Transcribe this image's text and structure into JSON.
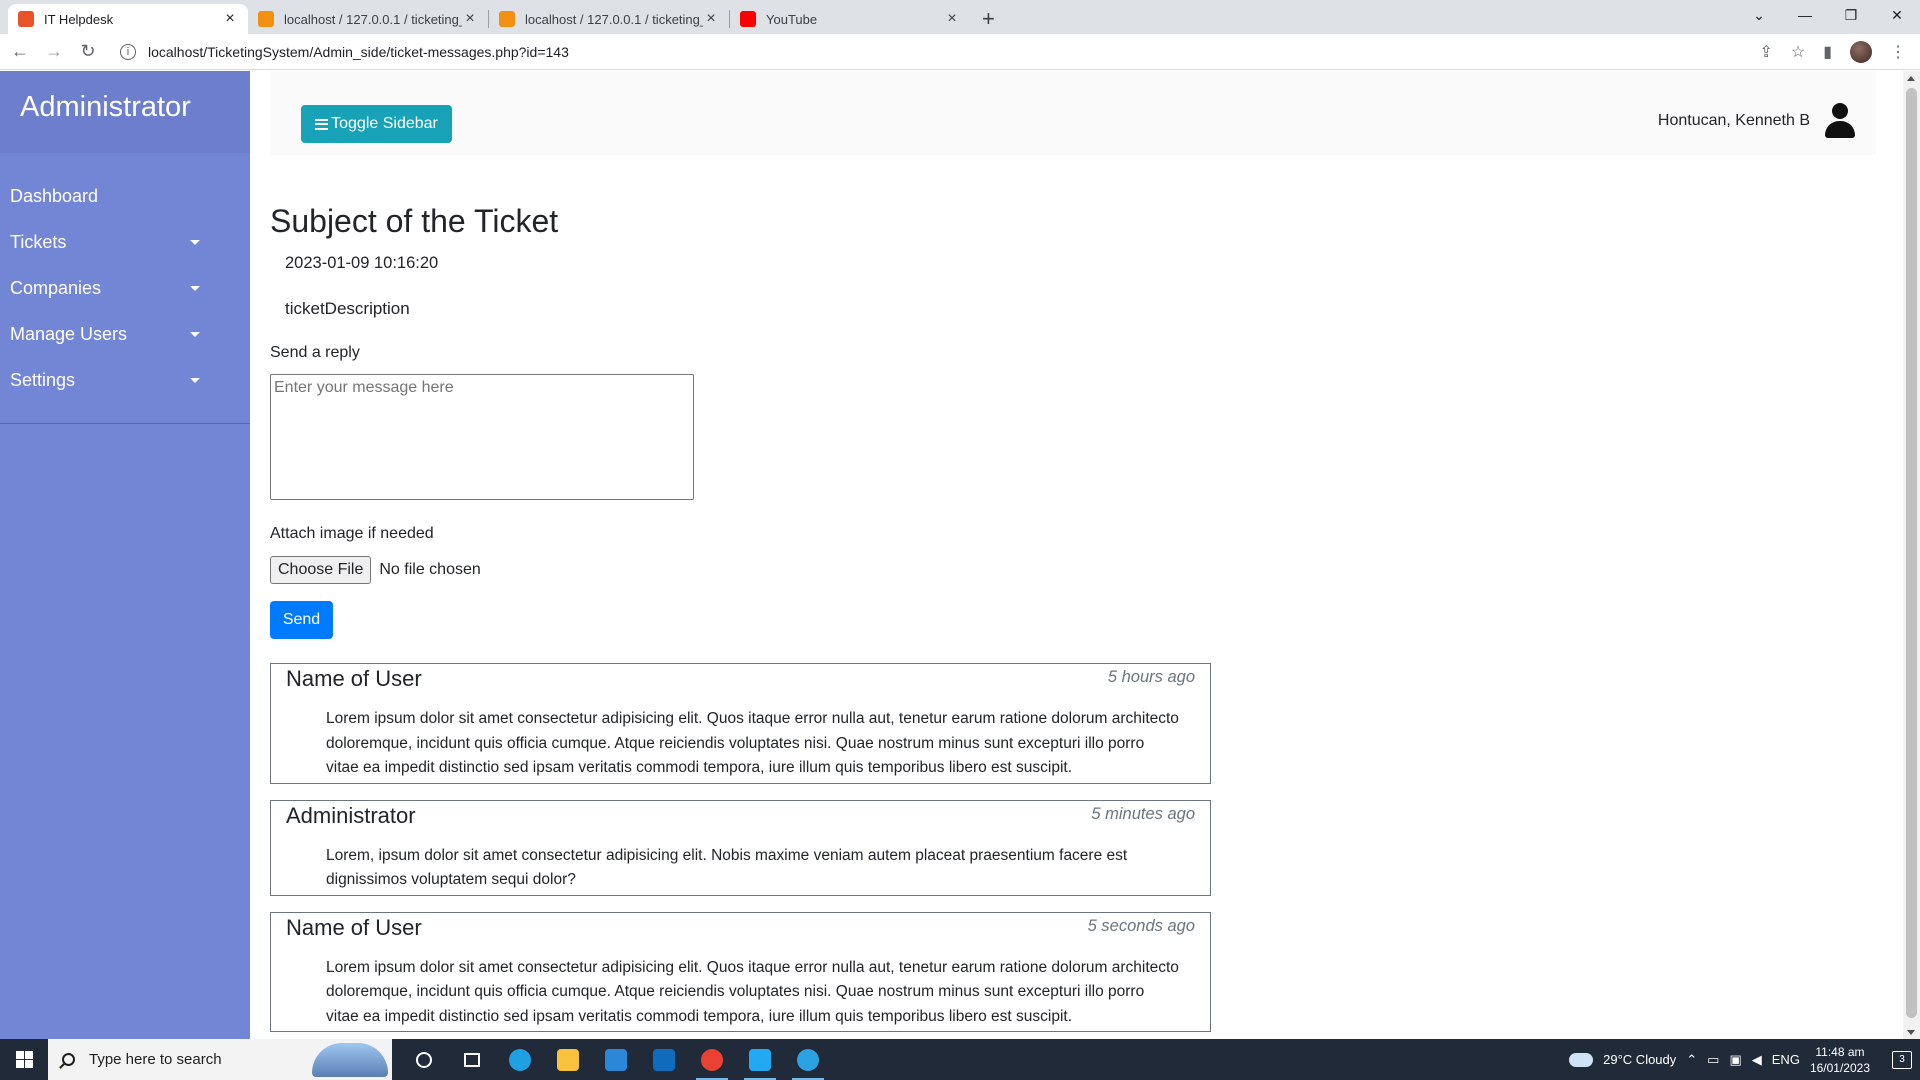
{
  "browser": {
    "tabs": [
      {
        "title": "IT Helpdesk",
        "active": true,
        "favicon_color": "#e8542a"
      },
      {
        "title": "localhost / 127.0.0.1 / ticketing_s",
        "active": false,
        "favicon_color": "#f29111"
      },
      {
        "title": "localhost / 127.0.0.1 / ticketing_s",
        "active": false,
        "favicon_color": "#f29111"
      },
      {
        "title": "YouTube",
        "active": false,
        "favicon_color": "#ff0000"
      }
    ],
    "url": "localhost/TicketingSystem/Admin_side/ticket-messages.php?id=143"
  },
  "sidebar": {
    "title": "Administrator",
    "items": [
      {
        "label": "Dashboard",
        "dropdown": false
      },
      {
        "label": "Tickets",
        "dropdown": true
      },
      {
        "label": "Companies",
        "dropdown": true
      },
      {
        "label": "Manage Users",
        "dropdown": true
      },
      {
        "label": "Settings",
        "dropdown": true
      }
    ]
  },
  "topbar": {
    "toggle_label": "Toggle Sidebar",
    "user_name": "Hontucan, Kenneth B"
  },
  "ticket": {
    "subject": "Subject of the Ticket",
    "date": "2023-01-09 10:16:20",
    "description": "ticketDescription"
  },
  "reply_form": {
    "label": "Send a reply",
    "placeholder": "Enter your message here",
    "attach_label": "Attach image if needed",
    "file_button": "Choose File",
    "file_status": "No file chosen",
    "send_label": "Send"
  },
  "messages": [
    {
      "sender": "Name of User",
      "time": "5 hours ago",
      "body": "Lorem ipsum dolor sit amet consectetur adipisicing elit. Quos itaque error nulla aut, tenetur earum ratione dolorum architecto doloremque, incidunt quis officia cumque. Atque reiciendis voluptates nisi. Quae nostrum minus sunt excepturi illo porro vitae ea impedit distinctio sed ipsam veritatis commodi tempora, iure illum quis temporibus libero est suscipit."
    },
    {
      "sender": "Administrator",
      "time": "5 minutes ago",
      "body": "Lorem, ipsum dolor sit amet consectetur adipisicing elit. Nobis maxime veniam autem placeat praesentium facere est dignissimos voluptatem sequi dolor?"
    },
    {
      "sender": "Name of User",
      "time": "5 seconds ago",
      "body": "Lorem ipsum dolor sit amet consectetur adipisicing elit. Quos itaque error nulla aut, tenetur earum ratione dolorum architecto doloremque, incidunt quis officia cumque. Atque reiciendis voluptates nisi. Quae nostrum minus sunt excepturi illo porro vitae ea impedit distinctio sed ipsam veritatis commodi tempora, iure illum quis temporibus libero est suscipit."
    }
  ],
  "taskbar": {
    "search_placeholder": "Type here to search",
    "weather": "29°C  Cloudy",
    "language": "ENG",
    "time": "11:48 am",
    "date": "16/01/2023",
    "notification_count": "3",
    "apps": [
      {
        "icon": "cortana-icon",
        "color": "#ffffff"
      },
      {
        "icon": "task-view-icon",
        "color": "#ffffff"
      },
      {
        "icon": "edge-icon",
        "color": "#1fa0e3"
      },
      {
        "icon": "file-explorer-icon",
        "color": "#f8c23c"
      },
      {
        "icon": "store-icon",
        "color": "#2b88d8"
      },
      {
        "icon": "mail-icon",
        "color": "#0f6cbd"
      },
      {
        "icon": "chrome-icon",
        "color": "#e94235"
      },
      {
        "icon": "vscode-icon",
        "color": "#23a9f2"
      },
      {
        "icon": "telegram-icon",
        "color": "#2aa3e0"
      }
    ]
  },
  "colors": {
    "sidebar_bg": "#7386d5",
    "sidebar_header_bg": "#6d7fcc",
    "toggle_btn": "#17a2b8",
    "send_btn": "#007bff"
  }
}
